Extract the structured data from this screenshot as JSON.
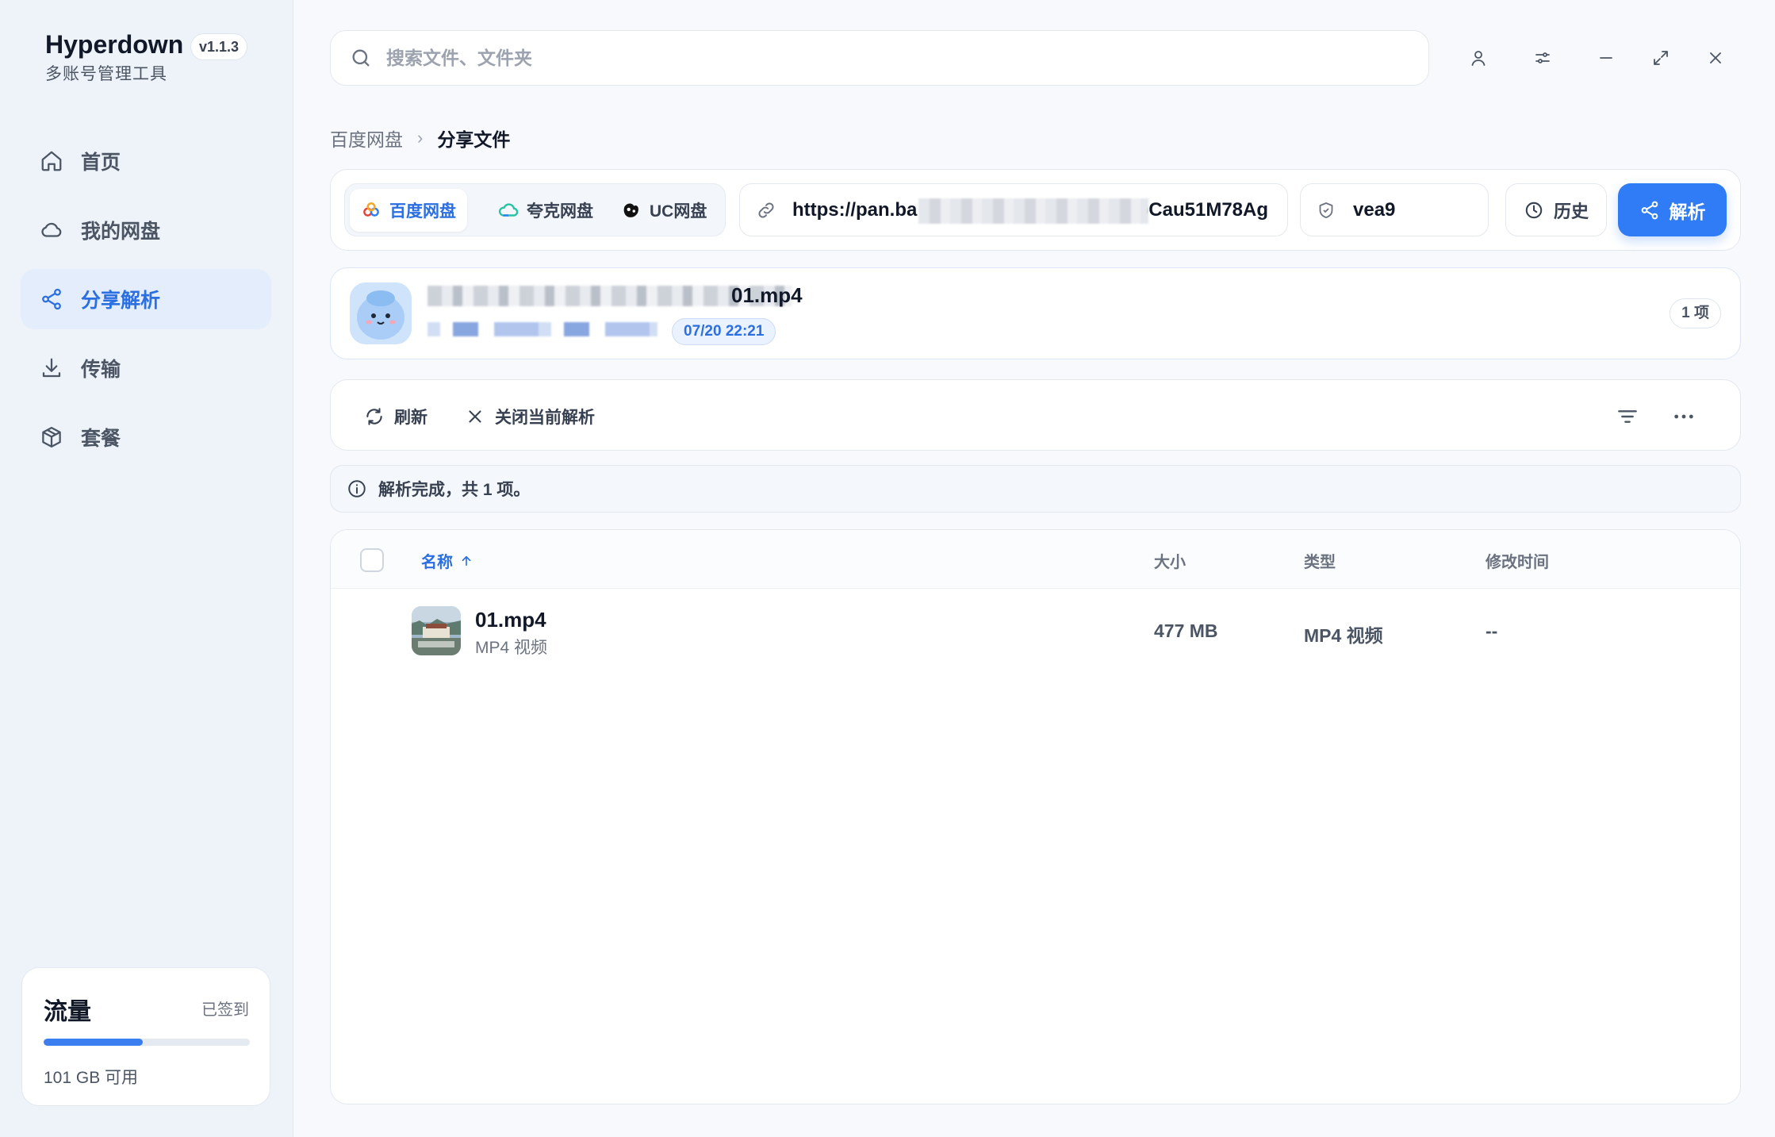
{
  "app": {
    "name": "Hyperdown",
    "version": "v1.1.3",
    "subtitle": "多账号管理工具"
  },
  "sidebar": {
    "items": [
      {
        "label": "首页",
        "icon": "home-icon"
      },
      {
        "label": "我的网盘",
        "icon": "cloud-icon"
      },
      {
        "label": "分享解析",
        "icon": "share-icon",
        "active": true
      },
      {
        "label": "传输",
        "icon": "download-icon"
      },
      {
        "label": "套餐",
        "icon": "package-icon"
      }
    ]
  },
  "quota": {
    "title": "流量",
    "status": "已签到",
    "used_fraction": 0.48,
    "available": "101 GB 可用"
  },
  "search": {
    "placeholder": "搜索文件、文件夹"
  },
  "breadcrumb": {
    "parent": "百度网盘",
    "separator": "›",
    "current": "分享文件"
  },
  "providers": [
    {
      "label": "百度网盘",
      "icon": "baidu-icon",
      "active": true
    },
    {
      "label": "夸克网盘",
      "icon": "quark-icon"
    },
    {
      "label": "UC网盘",
      "icon": "uc-icon"
    }
  ],
  "share_input": {
    "url_prefix": "https://pan.ba",
    "url_suffix": "bCau51M78Ag",
    "code": "vea9",
    "history_label": "历史",
    "parse_label": "解析"
  },
  "share_card": {
    "title": "01.mp4",
    "date": "07/20 22:21",
    "count": "1 项"
  },
  "toolbar": {
    "refresh_label": "刷新",
    "close_label": "关闭当前解析"
  },
  "info": {
    "message": "解析完成，共 1 项。"
  },
  "table": {
    "headers": {
      "name": "名称",
      "size": "大小",
      "type": "类型",
      "modified": "修改时间"
    },
    "rows": [
      {
        "name": "01.mp4",
        "subtype": "MP4 视频",
        "size": "477 MB",
        "type": "MP4 视频",
        "modified": "--"
      }
    ]
  },
  "colors": {
    "accent": "#2f7cf6",
    "sidebar_bg": "#eef3fa",
    "page_bg": "#f7f9fd"
  }
}
